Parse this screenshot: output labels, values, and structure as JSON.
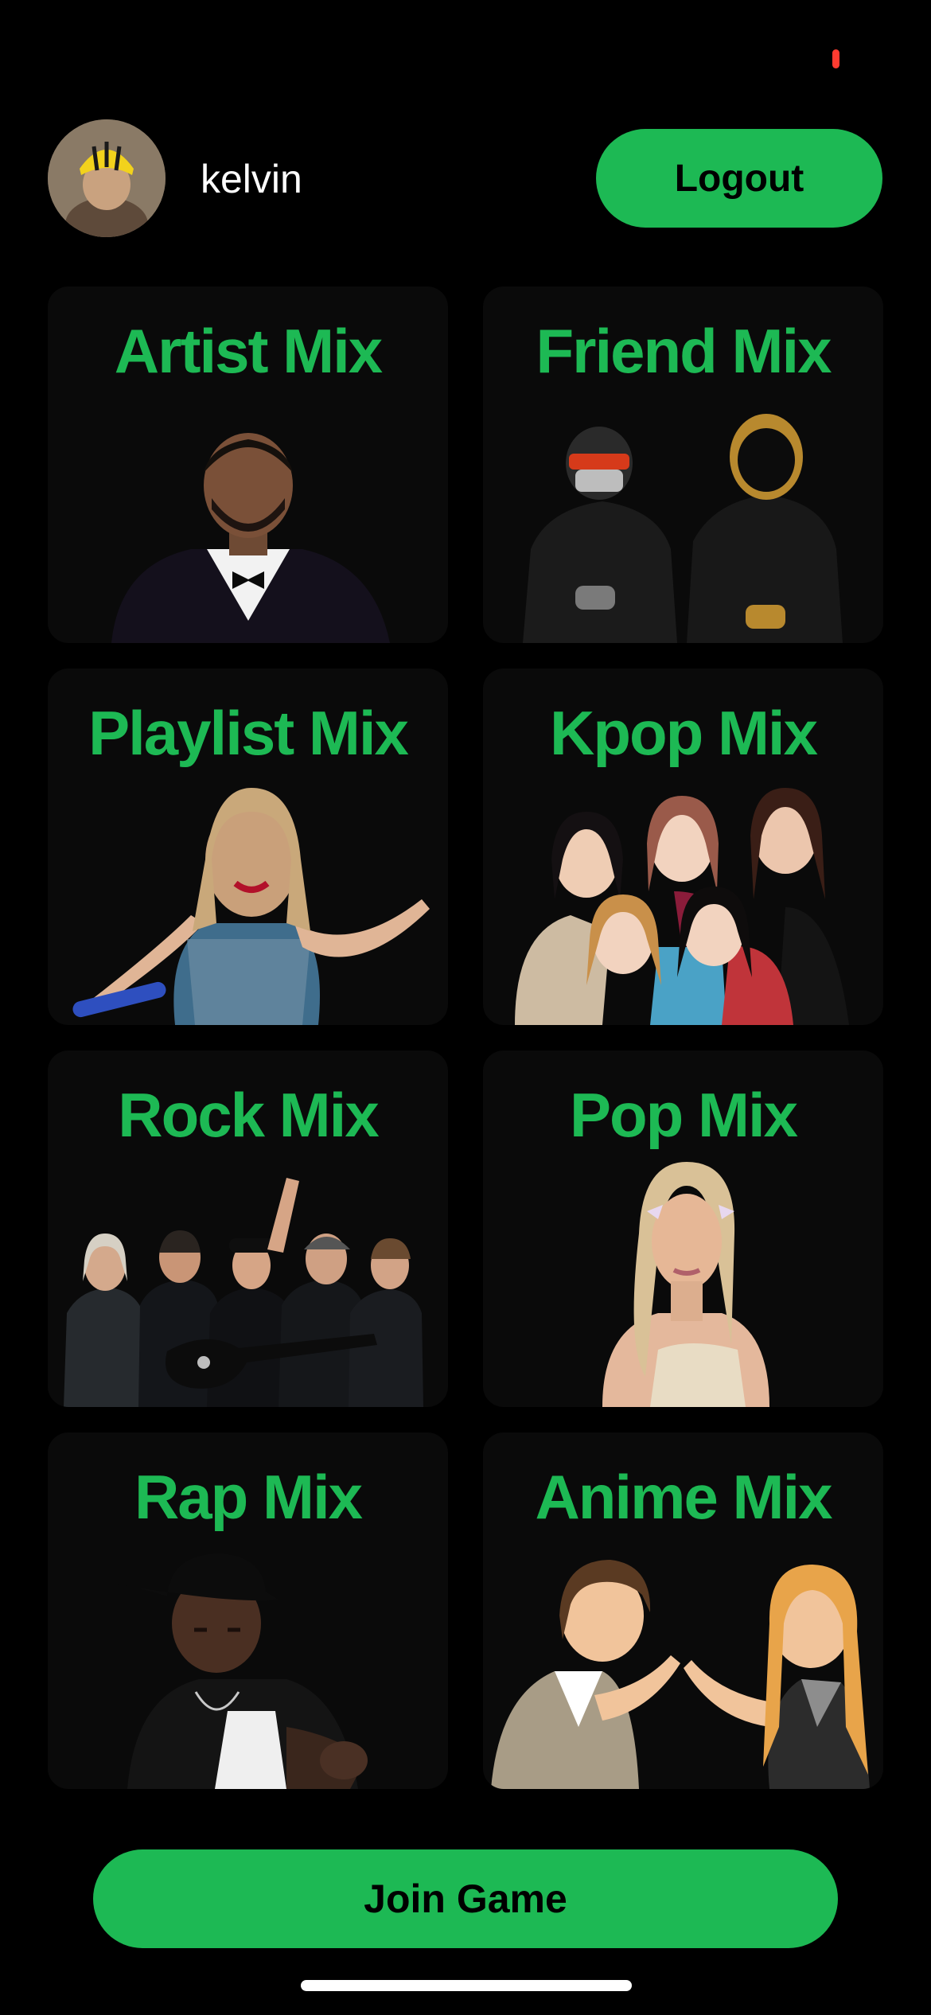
{
  "header": {
    "username": "kelvin",
    "logout_label": "Logout"
  },
  "mixes": [
    {
      "title": "Artist Mix"
    },
    {
      "title": "Friend Mix"
    },
    {
      "title": "Playlist Mix"
    },
    {
      "title": "Kpop Mix"
    },
    {
      "title": "Rock Mix"
    },
    {
      "title": "Pop Mix"
    },
    {
      "title": "Rap Mix"
    },
    {
      "title": "Anime Mix"
    }
  ],
  "footer": {
    "join_label": "Join Game"
  },
  "colors": {
    "accent": "#1db954",
    "background": "#000000",
    "card": "#0a0a0a",
    "recording_dot": "#ff3b30"
  }
}
